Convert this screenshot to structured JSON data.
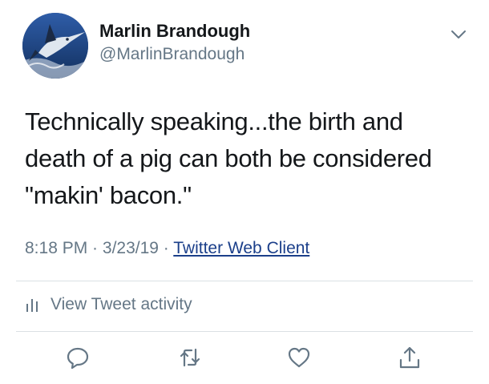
{
  "user": {
    "display_name": "Marlin Brandough",
    "handle": "@MarlinBrandough",
    "avatar_icon": "marlin-avatar"
  },
  "tweet": {
    "text": "Technically speaking...the birth and\ndeath of a pig can both be considered\n\"makin' bacon.\"",
    "time": "8:18 PM",
    "separator": " · ",
    "date": "3/23/19",
    "source": "Twitter Web Client"
  },
  "activity": {
    "label": "View Tweet activity",
    "icon": "bar-chart-icon"
  },
  "actions": {
    "reply": "reply-icon",
    "retweet": "retweet-icon",
    "like": "heart-icon",
    "share": "share-icon"
  },
  "colors": {
    "text": "#14171a",
    "secondary": "#657786",
    "link": "#1b3f8a",
    "divider": "#dbe0e4"
  }
}
